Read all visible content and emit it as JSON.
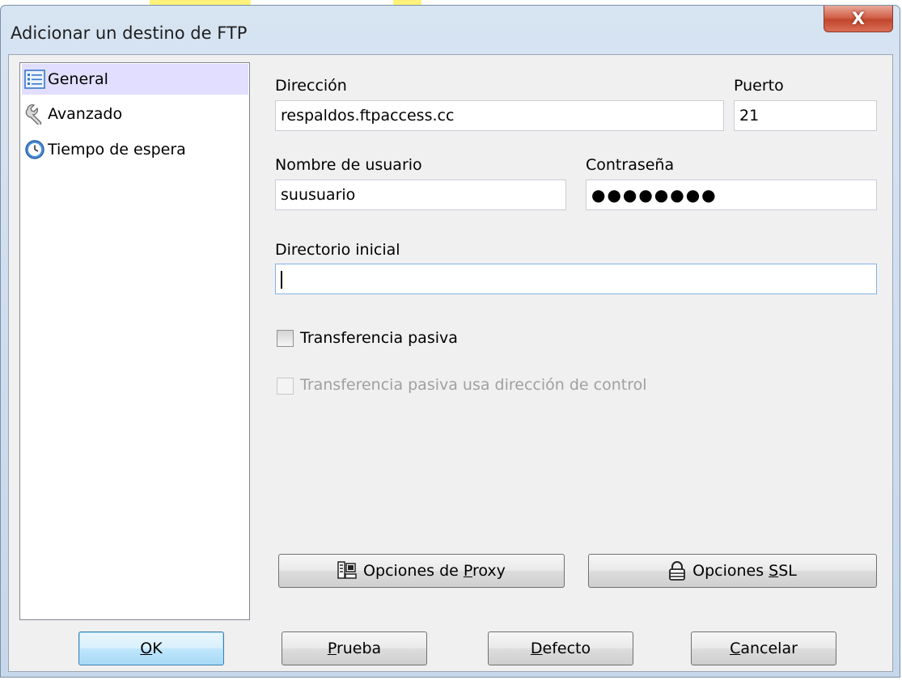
{
  "window": {
    "title": "Adicionar un destino de FTP",
    "close_label": "X"
  },
  "nav": {
    "items": [
      {
        "label": "General",
        "icon": "list-icon",
        "selected": true
      },
      {
        "label": "Avanzado",
        "icon": "wrench-icon",
        "selected": false
      },
      {
        "label": "Tiempo de espera",
        "icon": "clock-icon",
        "selected": false
      }
    ]
  },
  "form": {
    "address": {
      "label": "Dirección",
      "value": "respaldos.ftpaccess.cc"
    },
    "port": {
      "label": "Puerto",
      "value": "21"
    },
    "username": {
      "label": "Nombre de usuario",
      "value": "suusuario"
    },
    "password": {
      "label": "Contraseña",
      "value": "●●●●●●●●"
    },
    "initial_dir": {
      "label": "Directorio inicial",
      "value": ""
    },
    "passive": {
      "label": "Transferencia pasiva",
      "checked": false,
      "enabled": true
    },
    "passive_control": {
      "label": "Transferencia pasiva usa dirección de control",
      "checked": false,
      "enabled": false
    }
  },
  "buttons": {
    "proxy": {
      "pre": "Opciones de ",
      "accel": "P",
      "post": "roxy",
      "icon": "proxy-icon"
    },
    "ssl": {
      "pre": "Opciones ",
      "accel": "S",
      "post": "SL",
      "icon": "lock-icon"
    },
    "ok": {
      "pre": "",
      "accel": "O",
      "post": "K"
    },
    "test": {
      "pre": "",
      "accel": "P",
      "post": "rueba"
    },
    "default": {
      "pre": "",
      "accel": "D",
      "post": "efecto"
    },
    "cancel": {
      "pre": "",
      "accel": "C",
      "post": "ancelar"
    }
  },
  "colors": {
    "nav_selected": "#e1deff",
    "default_button": "#bee6fd",
    "close_button": "#c7503a"
  }
}
